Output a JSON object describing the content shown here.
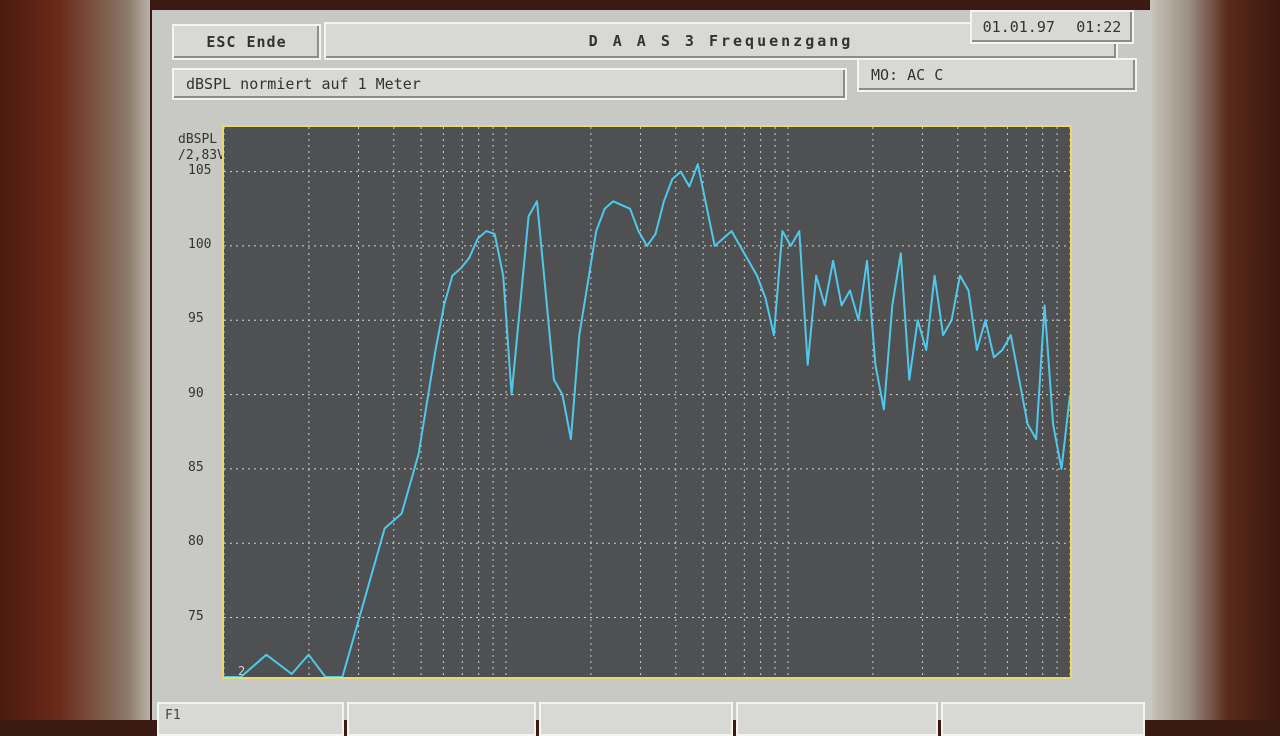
{
  "header": {
    "esc_label": "ESC  Ende",
    "title": "D A A S 3   Frequenzgang",
    "date": "01.01.97",
    "time": "01:22"
  },
  "info": {
    "subtitle": "dBSPL normiert auf 1 Meter",
    "mode": "MO: AC C"
  },
  "chart_data": {
    "type": "line",
    "ylabel": "dBSPL\n/2,83V",
    "y_ticks": [
      105,
      100,
      95,
      90,
      85,
      80,
      75
    ],
    "ylim": [
      71,
      108
    ],
    "x_tick_first": "2",
    "line_color": "#4fc8ea",
    "grid": true,
    "series": [
      {
        "x": [
          0,
          2,
          5,
          8,
          10,
          12,
          14,
          15,
          17,
          19,
          21,
          23,
          25,
          26,
          27,
          28,
          29,
          30,
          31,
          32,
          33,
          34,
          35,
          36,
          37,
          38,
          39,
          40,
          41,
          42,
          44,
          45,
          46,
          48,
          49,
          50,
          51,
          52,
          53,
          54,
          55,
          56,
          58,
          60,
          62,
          63,
          64,
          65,
          66,
          67,
          68,
          69,
          70,
          71,
          72,
          73,
          74,
          75,
          76,
          77,
          78,
          79,
          80,
          81,
          82,
          83,
          84,
          85,
          86,
          87,
          88,
          89,
          90,
          91,
          92,
          93,
          94,
          95,
          96,
          97,
          98,
          99,
          100
        ],
        "y": [
          71,
          71,
          72.5,
          71.2,
          72.5,
          71,
          71,
          73,
          77,
          81,
          82,
          86,
          93,
          96,
          98,
          98.5,
          99.2,
          100.5,
          101,
          100.8,
          98,
          90,
          96,
          102,
          103,
          97,
          91,
          90,
          87,
          94,
          101,
          102.5,
          103,
          102.5,
          101,
          100,
          100.8,
          103,
          104.5,
          105,
          104,
          105.5,
          100,
          101,
          99,
          98,
          96.5,
          94,
          101,
          100,
          101,
          92,
          98,
          96,
          99,
          96,
          97,
          95,
          99,
          92,
          89,
          96,
          99.5,
          91,
          95,
          93,
          98,
          94,
          95,
          98,
          97,
          93,
          95,
          92.5,
          93,
          94,
          91,
          88,
          87,
          96,
          88,
          85,
          90
        ]
      }
    ]
  },
  "bottom_buttons": [
    "F1",
    "",
    "",
    "",
    ""
  ]
}
